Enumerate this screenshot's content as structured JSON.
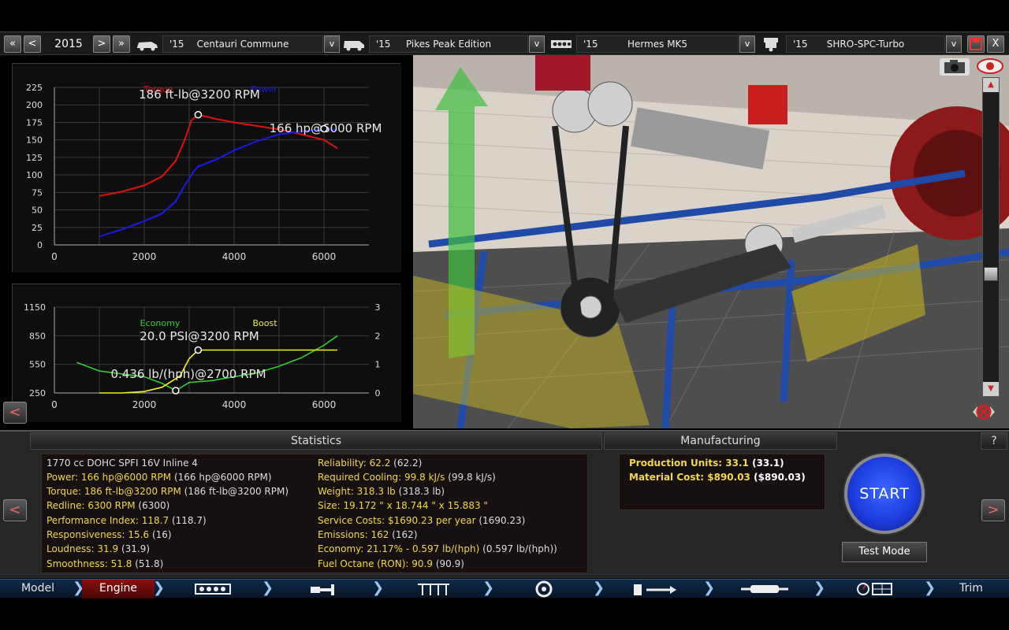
{
  "topbar": {
    "year": "2015",
    "car_model": {
      "year": "'15",
      "name": "Centauri Commune"
    },
    "trim": {
      "year": "'15",
      "name": "Pikes Peak Edition"
    },
    "engine_family": {
      "year": "'15",
      "name": "Hermes MK5"
    },
    "engine_variant": {
      "year": "'15",
      "name": "SHRO-SPC-Turbo"
    },
    "prev_label": "<",
    "next_label": ">",
    "dropdown_label": "v",
    "close_label": "X"
  },
  "power_chart": {
    "torque_label": "Torque",
    "power_label": "Power",
    "torque_annotation": "186 ft-lb@3200 RPM",
    "power_annotation": "166 hp@6000 RPM",
    "y_ticks": [
      "225",
      "200",
      "175",
      "150",
      "125",
      "100",
      "75",
      "50",
      "25",
      "0"
    ],
    "x_ticks": [
      "0",
      "2000",
      "4000",
      "6000"
    ]
  },
  "eco_chart": {
    "economy_label": "Economy",
    "boost_label": "Boost",
    "boost_annotation": "20.0 PSI@3200 RPM",
    "economy_annotation": "0.436 lb/(hph)@2700 RPM",
    "y_left_ticks": [
      "1150",
      "850",
      "550",
      "250"
    ],
    "y_right_ticks": [
      "3",
      "2",
      "1",
      "0"
    ],
    "x_ticks": [
      "0",
      "2000",
      "4000",
      "6000"
    ]
  },
  "chart_data": [
    {
      "type": "line",
      "xlabel": "",
      "ylabel": "",
      "xlim": [
        0,
        7000
      ],
      "ylim": [
        0,
        225
      ],
      "series": [
        {
          "name": "Torque",
          "color": "#e01010",
          "x": [
            1000,
            1500,
            2000,
            2400,
            2700,
            2900,
            3050,
            3200,
            3600,
            4000,
            4500,
            5000,
            5500,
            6000,
            6300
          ],
          "y": [
            70,
            76,
            85,
            98,
            120,
            150,
            178,
            186,
            180,
            175,
            170,
            165,
            158,
            150,
            138
          ]
        },
        {
          "name": "Power",
          "color": "#1a1ae8",
          "x": [
            1000,
            1500,
            2000,
            2400,
            2700,
            2900,
            3100,
            3200,
            3600,
            4000,
            4500,
            5000,
            5500,
            6000,
            6300
          ],
          "y": [
            12,
            22,
            34,
            45,
            62,
            85,
            105,
            112,
            122,
            135,
            148,
            158,
            162,
            166,
            164
          ]
        }
      ]
    },
    {
      "type": "line",
      "xlabel": "",
      "ylabel": "",
      "xlim": [
        0,
        7000
      ],
      "ylim": [
        250,
        1150
      ],
      "y2lim": [
        0,
        3
      ],
      "series": [
        {
          "name": "Economy",
          "color": "#33cc33",
          "x": [
            500,
            1000,
            1500,
            2000,
            2400,
            2700,
            3000,
            3500,
            4000,
            4500,
            5000,
            5500,
            6000,
            6300
          ],
          "y": [
            570,
            480,
            450,
            420,
            350,
            275,
            360,
            380,
            420,
            460,
            530,
            620,
            750,
            850
          ]
        },
        {
          "name": "Boost",
          "color": "#f0f020",
          "axis": "right",
          "x": [
            1000,
            1500,
            2000,
            2400,
            2800,
            3000,
            3200,
            4000,
            5000,
            6000,
            6300
          ],
          "y": [
            0.0,
            0.0,
            0.05,
            0.2,
            0.6,
            1.2,
            1.5,
            1.5,
            1.5,
            1.5,
            1.5
          ]
        }
      ]
    }
  ],
  "statistics": {
    "header": "Statistics",
    "left": [
      {
        "label": "1770 cc DOHC SPFI 16V Inline 4",
        "value": ""
      },
      {
        "label": "Power: 166 hp@6000 RPM",
        "value": "(166 hp@6000 RPM)"
      },
      {
        "label": "Torque: 186 ft-lb@3200 RPM",
        "value": "(186 ft-lb@3200 RPM)"
      },
      {
        "label": "Redline: 6300 RPM",
        "value": "(6300)"
      },
      {
        "label": "Performance Index: 118.7",
        "value": "(118.7)"
      },
      {
        "label": "Responsiveness: 15.6",
        "value": "(16)"
      },
      {
        "label": "Loudness: 31.9",
        "value": "(31.9)"
      },
      {
        "label": "Smoothness: 51.8",
        "value": "(51.8)"
      }
    ],
    "right": [
      {
        "label": "Reliability: 62.2",
        "value": "(62.2)"
      },
      {
        "label": "Required Cooling: 99.8 kJ/s",
        "value": "(99.8 kJ/s)"
      },
      {
        "label": "Weight: 318.3 lb",
        "value": "(318.3 lb)"
      },
      {
        "label": "Size: 19.172 \" x 18.744 \" x 15.883 \"",
        "value": ""
      },
      {
        "label": "Service Costs: $1690.23 per year",
        "value": "(1690.23)"
      },
      {
        "label": "Emissions: 162",
        "value": "(162)"
      },
      {
        "label": "Economy: 21.17% - 0.597 lb/(hph)",
        "value": "(0.597 lb/(hph))"
      },
      {
        "label": "Fuel Octane (RON): 90.9",
        "value": "(90.9)"
      }
    ]
  },
  "manufacturing": {
    "header": "Manufacturing",
    "rows": [
      {
        "label": "Production Units: 33.1",
        "value": "(33.1)"
      },
      {
        "label": "Material Cost: $890.03",
        "value": "($890.03)"
      }
    ],
    "help_label": "?",
    "start_label": "START",
    "test_mode_label": "Test Mode"
  },
  "tabs": {
    "model": "Model",
    "engine": "Engine",
    "trim": "Trim"
  },
  "colors": {
    "accent_yellow": "#f4d64a",
    "torque_red": "#e01010",
    "power_blue": "#1a1ae8",
    "economy_green": "#33cc33",
    "boost_yellow": "#f0f020",
    "start_blue": "#1d3ee0",
    "active_tab": "#8a0f0f"
  }
}
